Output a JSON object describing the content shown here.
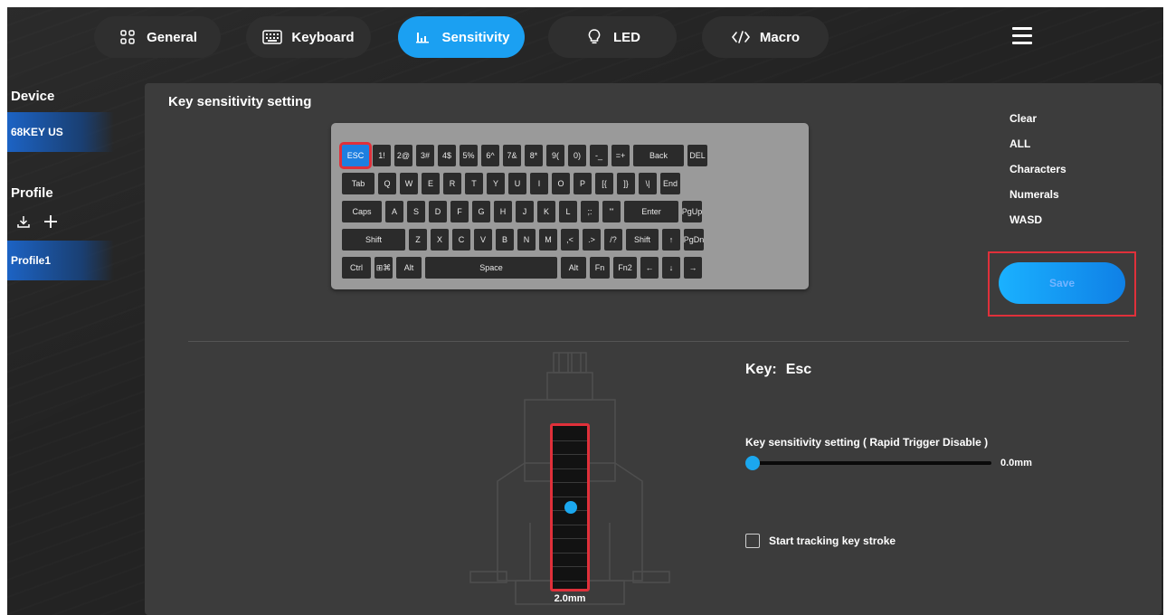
{
  "nav": {
    "tabs": [
      {
        "label": "General",
        "icon": "grid-icon",
        "active": false
      },
      {
        "label": "Keyboard",
        "icon": "keyboard-icon",
        "active": false
      },
      {
        "label": "Sensitivity",
        "icon": "bar-chart-icon",
        "active": true
      },
      {
        "label": "LED",
        "icon": "lightbulb-icon",
        "active": false
      },
      {
        "label": "Macro",
        "icon": "code-icon",
        "active": false
      }
    ],
    "menu_icon": "hamburger-menu-icon"
  },
  "sidebar": {
    "device_heading": "Device",
    "device_name": "68KEY US",
    "profile_heading": "Profile",
    "import_icon": "download-icon",
    "add_icon": "plus-icon",
    "profiles": [
      "Profile1"
    ]
  },
  "panel": {
    "title": "Key sensitivity setting",
    "keyboard": {
      "rows": [
        [
          "ESC",
          "1!",
          "2@",
          "3#",
          "4$",
          "5%",
          "6^",
          "7&",
          "8*",
          "9(",
          "0)",
          "-_",
          "=+",
          "Back",
          "DEL"
        ],
        [
          "Tab",
          "Q",
          "W",
          "E",
          "R",
          "T",
          "Y",
          "U",
          "I",
          "O",
          "P",
          "[{",
          "]}",
          "\\|",
          "End"
        ],
        [
          "Caps",
          "A",
          "S",
          "D",
          "F",
          "G",
          "H",
          "J",
          "K",
          "L",
          ";:",
          "'\"",
          "Enter",
          "PgUp"
        ],
        [
          "Shift",
          "Z",
          "X",
          "C",
          "V",
          "B",
          "N",
          "M",
          ",<",
          ".>",
          "/?",
          "Shift",
          "↑",
          "PgDn"
        ],
        [
          "Ctrl",
          "⊞⌘",
          "Alt",
          "Space",
          "Alt",
          "Fn",
          "Fn2",
          "←",
          "↓",
          "→"
        ]
      ],
      "selected_key": "ESC"
    },
    "select_options": [
      "Clear",
      "ALL",
      "Characters",
      "Numerals",
      "WASD"
    ],
    "save_label": "Save",
    "key_label": "Key:",
    "key_value": "Esc",
    "sensitivity_label": "Key sensitivity setting ( Rapid Trigger Disable )",
    "sensitivity_value": "0.0mm",
    "sensitivity_fraction": 0.0,
    "travel_value": "2.0mm",
    "travel_fraction": 0.5,
    "tracking_label": "Start tracking key stroke",
    "tracking_checked": false
  },
  "colors": {
    "accent": "#1ba0f2",
    "highlight": "#e0303a",
    "background": "#232323",
    "panel": "#3c3c3c"
  }
}
